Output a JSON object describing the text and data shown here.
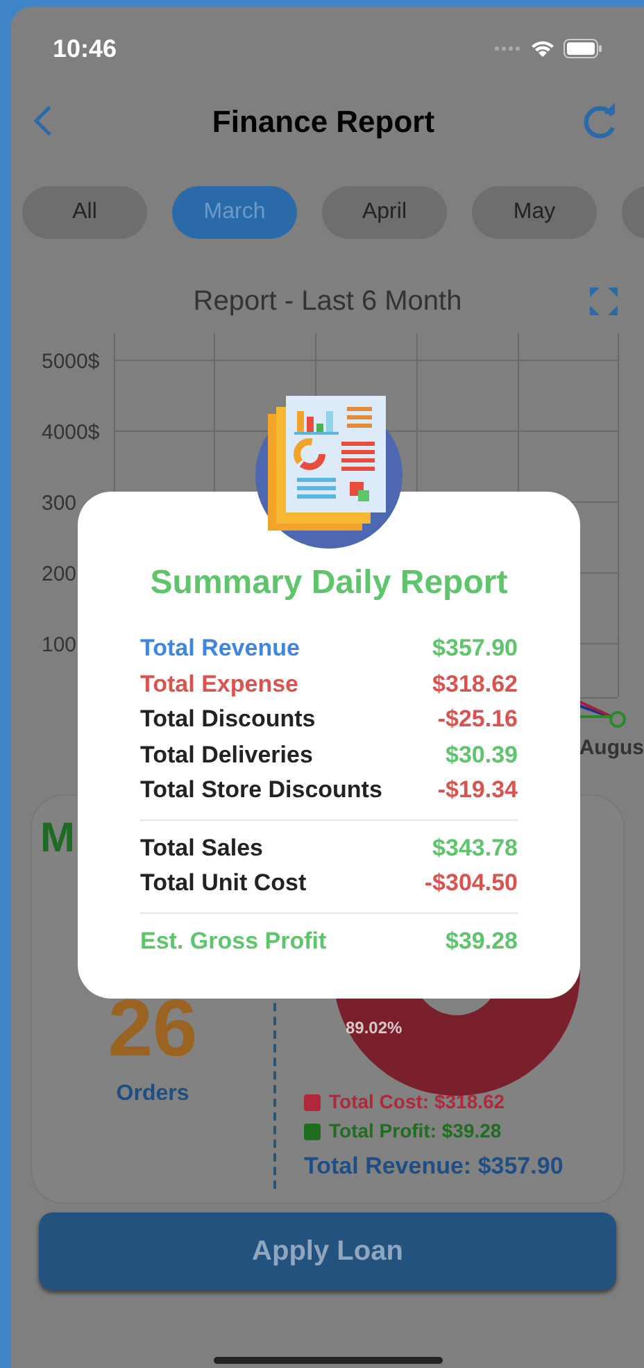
{
  "status_bar": {
    "time": "10:46"
  },
  "header": {
    "title": "Finance Report"
  },
  "month_tabs": [
    {
      "label": "All",
      "selected": false
    },
    {
      "label": "March",
      "selected": true
    },
    {
      "label": "April",
      "selected": false
    },
    {
      "label": "May",
      "selected": false
    }
  ],
  "chart": {
    "title": "Report - Last 6 Month",
    "y_labels": [
      "5000$",
      "4000$",
      "300",
      "200",
      "100"
    ],
    "x_labels": [
      "Augus"
    ]
  },
  "summary_card": {
    "title_fragment": "M",
    "orders_count": "26",
    "orders_label": "Orders",
    "donut_label": "89.02%",
    "legend": [
      {
        "label": "Total Cost: $318.62",
        "color": "#b0283a"
      },
      {
        "label": "Total Profit: $39.28",
        "color": "#1f6e1f"
      }
    ],
    "total": "Total Revenue: $357.90"
  },
  "apply_button": "Apply Loan",
  "dialog": {
    "title": "Summary Daily Report",
    "sections": [
      {
        "rows": [
          {
            "label": "Total Revenue",
            "value": "$357.90",
            "kind": "revenue"
          },
          {
            "label": "Total Expense",
            "value": "$318.62",
            "kind": "expense"
          },
          {
            "label": "Total Discounts",
            "value": "-$25.16",
            "kind": "deduction"
          },
          {
            "label": "Total Deliveries",
            "value": "$30.39",
            "kind": "addition"
          },
          {
            "label": "Total Store Discounts",
            "value": "-$19.34",
            "kind": "deduction"
          }
        ]
      },
      {
        "rows": [
          {
            "label": "Total Sales",
            "value": "$343.78",
            "kind": "addition"
          },
          {
            "label": "Total Unit Cost",
            "value": "-$304.50",
            "kind": "deduction"
          }
        ]
      },
      {
        "rows": [
          {
            "label": "Est. Gross Profit",
            "value": "$39.28",
            "kind": "profit"
          }
        ]
      }
    ]
  }
}
